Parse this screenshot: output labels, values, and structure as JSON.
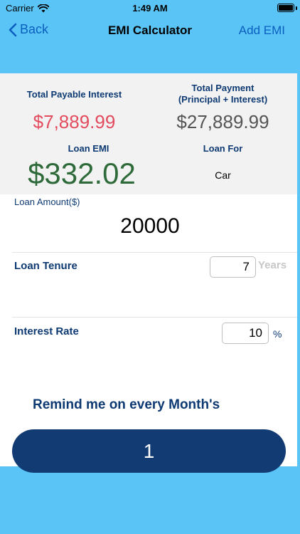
{
  "status": {
    "carrier": "Carrier",
    "time": "1:49 AM",
    "battery_level": 1.0
  },
  "nav": {
    "back_label": "Back",
    "title": "EMI Calculator",
    "action_label": "Add EMI"
  },
  "summary": {
    "interest_label": "Total Payable Interest",
    "interest_value": "$7,889.99",
    "payment_label_line1": "Total Payment",
    "payment_label_line2": "(Principal + Interest)",
    "payment_value": "$27,889.99",
    "emi_label": "Loan EMI",
    "emi_value": "$332.02",
    "loan_for_label": "Loan For",
    "loan_for_value": "Car"
  },
  "form": {
    "amount_label": "Loan Amount($)",
    "amount_value": "20000",
    "tenure_label": "Loan Tenure",
    "tenure_value": "7",
    "tenure_unit": "Years",
    "rate_label": "Interest Rate",
    "rate_value": "10",
    "rate_unit": "%"
  },
  "reminder": {
    "label": "Remind me on every Month's",
    "value": "1"
  },
  "colors": {
    "accent": "#5ac4f7",
    "interest_red": "#e34c5f",
    "emi_green": "#2f6b3a",
    "navy": "#133b73",
    "link_blue": "#0b5fbf"
  }
}
